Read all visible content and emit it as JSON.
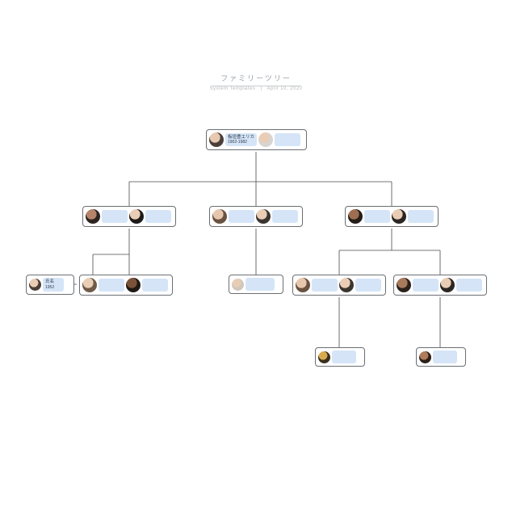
{
  "header": {
    "title": "ファミリーツリー",
    "subtitle_left": "System Templates",
    "subtitle_right": "April 10, 2020"
  },
  "gen1": {
    "p1": {
      "name": "板垣豊エリカ",
      "years": "1902-1982"
    },
    "p2": {
      "name": "",
      "years": ""
    }
  },
  "gen2": {
    "a": {
      "p1": {
        "name": "",
        "years": ""
      },
      "p2": {
        "name": "",
        "years": ""
      }
    },
    "b": {
      "p1": {
        "name": "",
        "years": ""
      },
      "p2": {
        "name": "",
        "years": ""
      }
    },
    "c": {
      "p1": {
        "name": "",
        "years": ""
      },
      "p2": {
        "name": "",
        "years": ""
      }
    }
  },
  "gen3": {
    "a_spouse": {
      "name": "氏名",
      "years": "1952"
    },
    "a_child": {
      "p1": {
        "name": "",
        "years": ""
      },
      "p2": {
        "name": "",
        "years": ""
      }
    },
    "b_child_label": "",
    "c_child1": {
      "p1": {
        "name": "",
        "years": ""
      },
      "p2": {
        "name": "",
        "years": ""
      }
    },
    "c_child2": {
      "p1": {
        "name": "",
        "years": ""
      },
      "p2": {
        "name": "",
        "years": ""
      }
    }
  },
  "gen4": {
    "c1_child_label": "",
    "c2_child_label": ""
  }
}
